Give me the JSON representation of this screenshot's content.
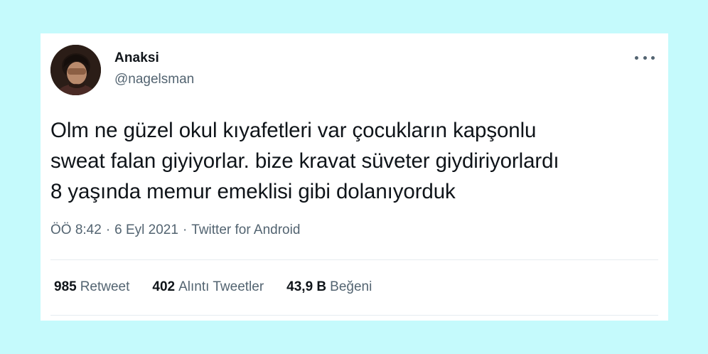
{
  "author": {
    "display_name": "Anaksi",
    "handle": "@nagelsman"
  },
  "tweet": {
    "lines": [
      "Olm ne güzel okul kıyafetleri var çocukların kapşonlu",
      "sweat falan giyiyorlar. bize kravat süveter giydiriyorlardı",
      "8 yaşında memur emeklisi gibi dolanıyorduk"
    ]
  },
  "meta": {
    "time": "ÖÖ 8:42",
    "separator": "·",
    "date": "6 Eyl 2021",
    "source": "Twitter for Android"
  },
  "stats": {
    "retweets": {
      "count": "985",
      "label": "Retweet"
    },
    "quotes": {
      "count": "402",
      "label": "Alıntı Tweetler"
    },
    "likes": {
      "count": "43,9 B",
      "label": "Beğeni"
    }
  },
  "colors": {
    "background": "#c5fafc",
    "card": "#ffffff",
    "primary_text": "#0f1419",
    "secondary_text": "#536471"
  },
  "icons": [
    "more-options-icon"
  ]
}
